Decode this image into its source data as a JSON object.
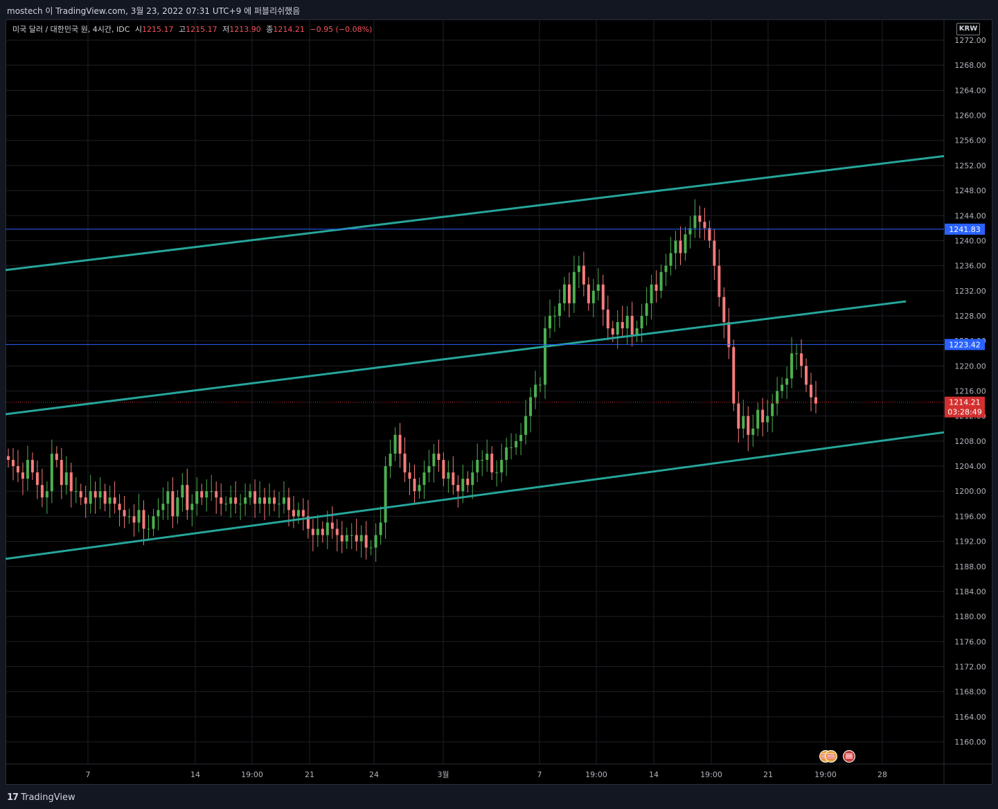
{
  "header": {
    "attribution": "mostech 이 TradingView.com, 3월 23, 2022 07:31 UTC+9 에 퍼블리쉬했음"
  },
  "legend": {
    "symbol": "미국 달러 / 대한민국 원, 4시간, IDC",
    "open_label": "시",
    "open": "1215.17",
    "high_label": "고",
    "high": "1215.17",
    "low_label": "저",
    "low": "1213.90",
    "close_label": "종",
    "close": "1214.21",
    "change": "−0.95 (−0.08%)"
  },
  "currency_button": "KRW",
  "footer": {
    "brand": "TradingView",
    "brand_icon": "17"
  },
  "colors": {
    "up": "#26a69a",
    "down": "#ef5350",
    "upBody": "#4caf50",
    "downBody": "#f77c7c",
    "channel": "#26a69a",
    "hline": "#2962ff",
    "price": "#d32f2f"
  },
  "chart_data": {
    "type": "candlestick",
    "title": "미국 달러 / 대한민국 원, 4시간, IDC",
    "ylim": [
      1156,
      1274
    ],
    "yticks": [
      1272,
      1268,
      1264,
      1260,
      1256,
      1252,
      1248,
      1244,
      1240,
      1236,
      1232,
      1228,
      1224,
      1220,
      1216,
      1212,
      1208,
      1204,
      1200,
      1196,
      1192,
      1188,
      1184,
      1180,
      1176,
      1172,
      1168,
      1164,
      1160
    ],
    "ytick_labels": [
      "1272.00",
      "1268.00",
      "1264.00",
      "1260.00",
      "1256.00",
      "1252.00",
      "1248.00",
      "1244.00",
      "1240.00",
      "1236.00",
      "1232.00",
      "1228.00",
      "1224.00",
      "1220.00",
      "1216.00",
      "1212.00",
      "1208.00",
      "1204.00",
      "1200.00",
      "1196.00",
      "1192.00",
      "1188.00",
      "1184.00",
      "1180.00",
      "1176.00",
      "1172.00",
      "1168.00",
      "1164.00",
      "1160.00"
    ],
    "xticks": [
      "7",
      "14",
      "19:00",
      "21",
      "24",
      "3월",
      "7",
      "19:00",
      "14",
      "19:00",
      "21",
      "19:00",
      "28"
    ],
    "horizontal_lines": [
      {
        "price": 1241.83,
        "label": "1241.83"
      },
      {
        "price": 1223.42,
        "label": "1223.42"
      }
    ],
    "last_price": {
      "price": 1214.21,
      "label": "1214.21",
      "countdown": "03:28:49"
    },
    "channel_lines_price": [
      {
        "name": "upper",
        "start": 1235.3,
        "end": 1253.5
      },
      {
        "name": "middle",
        "start": 1212.3,
        "end": 1230.3
      },
      {
        "name": "lower",
        "start": 1189.2,
        "end": 1209.4
      }
    ],
    "closes": [
      1205,
      1204,
      1203,
      1202,
      1205,
      1203,
      1201,
      1199,
      1200,
      1206,
      1205,
      1201,
      1203,
      1200,
      1200,
      1199,
      1198,
      1200,
      1199,
      1200,
      1198,
      1199,
      1198,
      1197,
      1196,
      1196,
      1195,
      1197,
      1194,
      1194,
      1196,
      1197,
      1198,
      1200,
      1196,
      1199,
      1201,
      1197,
      1198,
      1200,
      1199,
      1200,
      1200,
      1199,
      1198,
      1198,
      1199,
      1198,
      1198,
      1199,
      1200,
      1198,
      1199,
      1198,
      1199,
      1198,
      1198,
      1199,
      1197,
      1196,
      1197,
      1196,
      1194,
      1193,
      1194,
      1193,
      1195,
      1194,
      1193,
      1192,
      1193,
      1193,
      1192,
      1193,
      1191,
      1191,
      1193,
      1195,
      1204,
      1206,
      1209,
      1206,
      1203,
      1202,
      1200,
      1201,
      1203,
      1204,
      1206,
      1205,
      1202,
      1203,
      1201,
      1200,
      1202,
      1201,
      1203,
      1205,
      1205,
      1206,
      1203,
      1203,
      1205,
      1207,
      1207,
      1208,
      1209,
      1212,
      1215,
      1217,
      1217,
      1226,
      1228,
      1228,
      1230,
      1233,
      1230,
      1235,
      1236,
      1233,
      1230,
      1232,
      1233,
      1229,
      1226,
      1225,
      1227,
      1226,
      1228,
      1225,
      1226,
      1228,
      1230,
      1233,
      1232,
      1235,
      1236,
      1238,
      1240,
      1238,
      1241,
      1242,
      1244,
      1243,
      1242,
      1240,
      1236,
      1231,
      1227,
      1223,
      1214,
      1210,
      1212,
      1209,
      1210,
      1213,
      1211,
      1212,
      1214,
      1216,
      1217,
      1218,
      1222,
      1222,
      1220,
      1217,
      1215,
      1214
    ],
    "ohlc": []
  }
}
